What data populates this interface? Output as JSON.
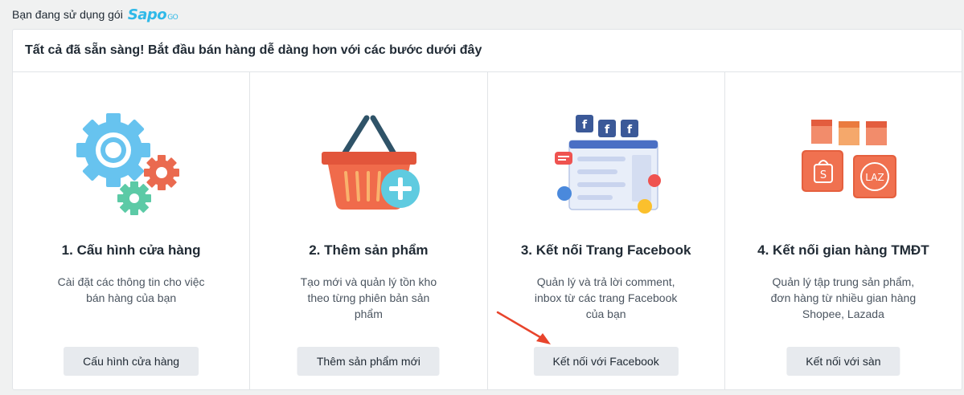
{
  "plan": {
    "label": "Bạn đang sử dụng gói",
    "logo_text": "Sapo",
    "logo_suffix": "GO"
  },
  "card": {
    "header": "Tất cả đã sẵn sàng! Bắt đầu bán hàng dễ dàng hơn với các bước dưới đây"
  },
  "steps": [
    {
      "icon": "gears-icon",
      "title": "1. Cấu hình cửa hàng",
      "description": "Cài đặt các thông tin cho việc bán hàng của bạn",
      "button": "Cấu hình cửa hàng"
    },
    {
      "icon": "basket-add-icon",
      "title": "2. Thêm sản phẩm",
      "description": "Tạo mới và quản lý tồn kho theo từng phiên bản sản phẩm",
      "button": "Thêm sản phẩm mới"
    },
    {
      "icon": "facebook-page-icon",
      "title": "3. Kết nối Trang Facebook",
      "description": "Quản lý và trả lời comment, inbox từ các trang Facebook của bạn",
      "button": "Kết nối với Facebook"
    },
    {
      "icon": "marketplace-icon",
      "title": "4. Kết nối gian hàng TMĐT",
      "description": "Quản lý tập trung sản phẩm, đơn hàng từ nhiều gian hàng Shopee, Lazada",
      "button": "Kết nối với sàn",
      "badges": [
        "S",
        "LAZ"
      ]
    }
  ],
  "colors": {
    "accent_blue": "#2fb9e8",
    "arrow_red": "#e8442c",
    "button_bg": "#e7eaee"
  }
}
